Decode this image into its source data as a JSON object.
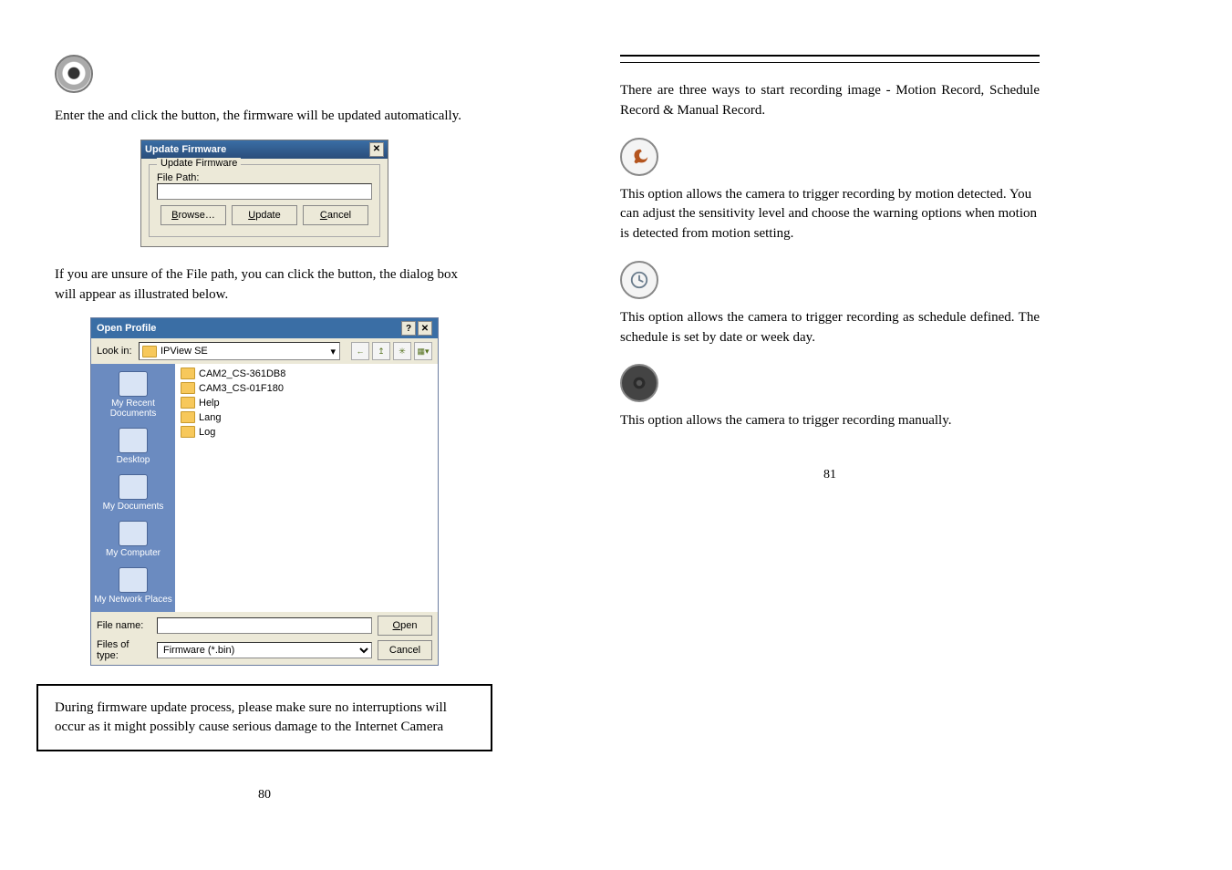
{
  "left": {
    "para1_a": "Enter the ",
    "para1_b": " and click the ",
    "para1_c": " button, the firmware will be updated automatically.",
    "para2_a": "If you are unsure of the File path, you can click the ",
    "para2_b": " button, the ",
    "para2_c": " dialog box will appear as illustrated below.",
    "warn": "During firmware update process, please make sure no interruptions will occur as it might possibly cause serious damage to the Internet Camera",
    "page_num": "80",
    "upd_dlg": {
      "title": "Update Firmware",
      "group": "Update Firmware",
      "file_path_label": "File Path:",
      "file_path_value": "",
      "browse": "Browse…",
      "update": "Update",
      "cancel": "Cancel"
    },
    "open_dlg": {
      "title": "Open Profile",
      "lookin_label": "Look in:",
      "lookin_value": "IPView SE",
      "places": [
        "My Recent Documents",
        "Desktop",
        "My Documents",
        "My Computer",
        "My Network Places"
      ],
      "items": [
        "CAM2_CS-361DB8",
        "CAM3_CS-01F180",
        "Help",
        "Lang",
        "Log"
      ],
      "filename_label": "File name:",
      "filename_value": "",
      "filetype_label": "Files of type:",
      "filetype_value": "Firmware (*.bin)",
      "open_btn": "Open",
      "cancel_btn": "Cancel",
      "nav_back": "←",
      "nav_up": "↥"
    }
  },
  "right": {
    "intro": "There are three ways to start recording image - Motion Record, Schedule Record & Manual Record.",
    "motion": "This option allows the camera to trigger recording by motion detected.  You can adjust the sensitivity level and choose the warning options when motion is detected from motion setting.",
    "schedule": "This option allows the camera to trigger recording as schedule defined.  The schedule is set by date or week day.",
    "manual": "This option allows the camera to trigger recording manually.",
    "page_num": "81"
  }
}
